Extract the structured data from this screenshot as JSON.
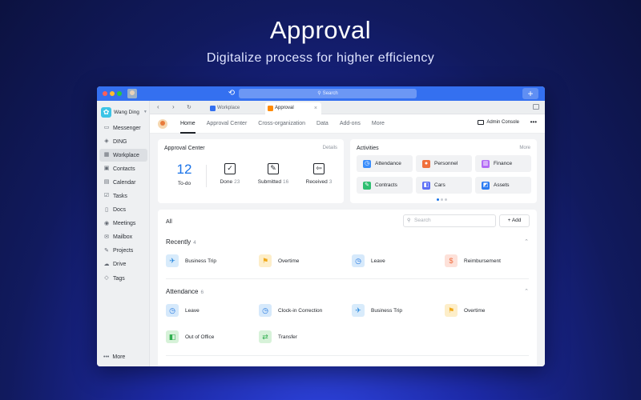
{
  "hero": {
    "title": "Approval",
    "subtitle": "Digitalize process for higher efficiency"
  },
  "titlebar": {
    "search_placeholder": "Search",
    "plus_label": "+"
  },
  "sidebar": {
    "user_name": "Wang Ding",
    "items": [
      {
        "label": "Messenger",
        "icon": "message-icon"
      },
      {
        "label": "DING",
        "icon": "ding-icon"
      },
      {
        "label": "Workplace",
        "icon": "grid-icon",
        "active": true
      },
      {
        "label": "Contacts",
        "icon": "contacts-icon"
      },
      {
        "label": "Calendar",
        "icon": "calendar-icon"
      },
      {
        "label": "Tasks",
        "icon": "tasks-icon"
      },
      {
        "label": "Docs",
        "icon": "docs-icon"
      },
      {
        "label": "Meetings",
        "icon": "meetings-icon"
      },
      {
        "label": "Mailbox",
        "icon": "mail-icon"
      },
      {
        "label": "Projects",
        "icon": "projects-icon"
      },
      {
        "label": "Drive",
        "icon": "drive-icon"
      },
      {
        "label": "Tags",
        "icon": "tag-icon"
      }
    ],
    "more_label": "More"
  },
  "tabs": [
    {
      "label": "Workplace",
      "color": "#3470f0"
    },
    {
      "label": "Approval",
      "color": "#ff8a00",
      "active": true
    }
  ],
  "subnav": {
    "items": [
      "Home",
      "Approval Center",
      "Cross-organization",
      "Data",
      "Add-ons",
      "More"
    ],
    "active": "Home",
    "admin_label": "Admin Console",
    "more_dots": "•••"
  },
  "approval_center": {
    "title": "Approval Center",
    "details_label": "Details",
    "todo_count": "12",
    "todo_label": "To-do",
    "done_label": "Done",
    "done_count": "23",
    "submitted_label": "Submitted",
    "submitted_count": "16",
    "received_label": "Received",
    "received_count": "3"
  },
  "activities": {
    "title": "Activities",
    "more_label": "More",
    "items": [
      {
        "label": "Attendance",
        "icon": "clock-icon",
        "color": "#3a8dfb"
      },
      {
        "label": "Personnel",
        "icon": "person-icon",
        "color": "#f0703c"
      },
      {
        "label": "Finance",
        "icon": "finance-icon",
        "color": "#b36cf5"
      },
      {
        "label": "Contracts",
        "icon": "contract-icon",
        "color": "#2fbf71"
      },
      {
        "label": "Cars",
        "icon": "car-icon",
        "color": "#5b6ef5"
      },
      {
        "label": "Assets",
        "icon": "assets-icon",
        "color": "#2b7bf2"
      }
    ]
  },
  "list": {
    "all_label": "All",
    "search_placeholder": "Search",
    "add_label": "+  Add",
    "sections": [
      {
        "title": "Recently",
        "count": "4",
        "items": [
          {
            "label": "Business Trip",
            "icon": "plane-icon",
            "bg": "#d8ebfb",
            "fg": "#2f8ce0"
          },
          {
            "label": "Overtime",
            "icon": "overtime-icon",
            "bg": "#fdeec9",
            "fg": "#f0a91a"
          },
          {
            "label": "Leave",
            "icon": "clock-icon",
            "bg": "#d6e9fb",
            "fg": "#2478e0"
          },
          {
            "label": "Reimbursement",
            "icon": "money-bag-icon",
            "bg": "#fde1d9",
            "fg": "#f06b3c"
          }
        ]
      },
      {
        "title": "Attendance",
        "count": "6",
        "items": [
          {
            "label": "Leave",
            "icon": "clock-icon",
            "bg": "#d6e9fb",
            "fg": "#2478e0"
          },
          {
            "label": "Clock-in Correction",
            "icon": "clock-icon",
            "bg": "#d6e9fb",
            "fg": "#2478e0"
          },
          {
            "label": "Business Trip",
            "icon": "plane-icon",
            "bg": "#d8ebfb",
            "fg": "#2f8ce0"
          },
          {
            "label": "Overtime",
            "icon": "overtime-icon",
            "bg": "#fdeec9",
            "fg": "#f0a91a"
          },
          {
            "label": "Out of Office",
            "icon": "car-icon",
            "bg": "#d7f2d9",
            "fg": "#2fae4d"
          },
          {
            "label": "Transfer",
            "icon": "transfer-icon",
            "bg": "#d7f2d9",
            "fg": "#2fae4d"
          }
        ]
      }
    ]
  }
}
